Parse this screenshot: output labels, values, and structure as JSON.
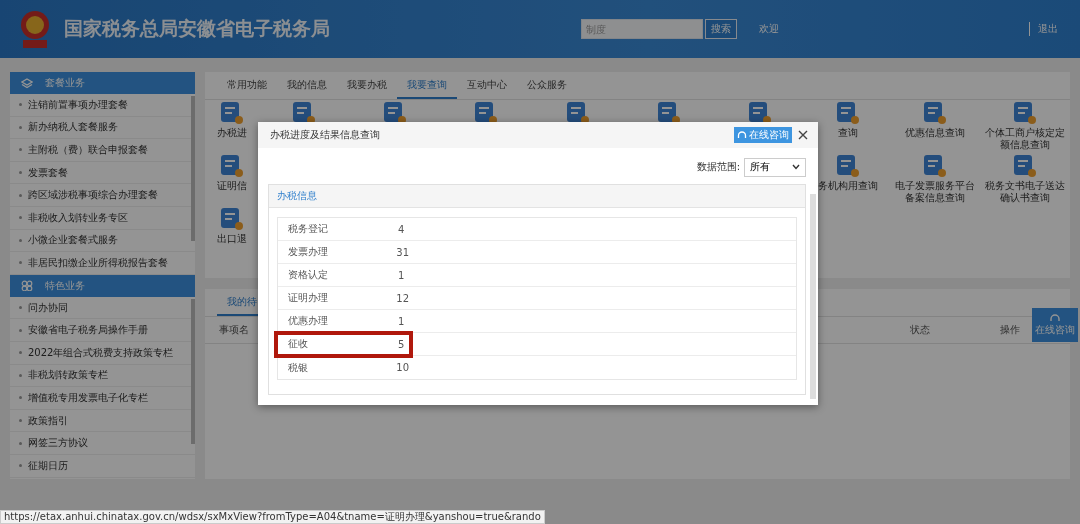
{
  "header": {
    "title": "国家税务总局安徽省电子税务局",
    "search": {
      "placeholder": "制度"
    },
    "search_button": "搜索",
    "welcome": "欢迎",
    "logout": "退出"
  },
  "sidebar": {
    "sections": [
      {
        "title": "套餐业务",
        "items": [
          "注销前置事项办理套餐",
          "新办纳税人套餐服务",
          "主附税（费）联合申报套餐",
          "发票套餐",
          "跨区域涉税事项综合办理套餐",
          "非税收入划转业务专区",
          "小微企业套餐式服务",
          "非居民扣缴企业所得税报告套餐"
        ]
      },
      {
        "title": "特色业务",
        "items": [
          "问办协同",
          "安徽省电子税务局操作手册",
          "2022年组合式税费支持政策专栏",
          "非税划转政策专栏",
          "增值税专用发票电子化专栏",
          "政策指引",
          "网签三方协议",
          "征期日历"
        ]
      }
    ]
  },
  "tabs": [
    {
      "label": "常用功能",
      "selected": false
    },
    {
      "label": "我的信息",
      "selected": false
    },
    {
      "label": "我要办税",
      "selected": false
    },
    {
      "label": "我要查询",
      "selected": true
    },
    {
      "label": "互动中心",
      "selected": false
    },
    {
      "label": "公众服务",
      "selected": false
    }
  ],
  "services": [
    [
      {
        "kind": "labeled",
        "label": "办税进"
      },
      {
        "kind": "icon"
      },
      {
        "kind": "icon"
      },
      {
        "kind": "icon"
      },
      {
        "kind": "icon"
      },
      {
        "kind": "icon"
      },
      {
        "kind": "icon"
      },
      {
        "kind": "labeled",
        "label": "查询"
      },
      {
        "kind": "labeled",
        "label": "优惠信息查询"
      },
      {
        "kind": "labeled",
        "label": "个体工商户核定定额信息查询"
      }
    ],
    [
      {
        "kind": "labeled",
        "label": "证明信"
      },
      {
        "kind": "blank"
      },
      {
        "kind": "blank"
      },
      {
        "kind": "blank"
      },
      {
        "kind": "blank"
      },
      {
        "kind": "blank"
      },
      {
        "kind": "blank"
      },
      {
        "kind": "labeled",
        "label": "务机构用查询"
      },
      {
        "kind": "labeled",
        "label": "电子发票服务平台备案信息查询"
      },
      {
        "kind": "labeled",
        "label": "税务文书电子送达确认书查询"
      }
    ],
    [
      {
        "kind": "labeled",
        "label": "出口退"
      }
    ]
  ],
  "todo": {
    "tab": "我的待",
    "columns": [
      "事项名",
      "状态",
      "操作"
    ]
  },
  "float_button": "在线咨询",
  "modal": {
    "title": "办税进度及结果信息查询",
    "consult_button": "在线咨询",
    "filter": {
      "label": "数据范围:",
      "value": "所有"
    },
    "panel_title": "办税信息",
    "rows": [
      {
        "name": "税务登记",
        "count": "4",
        "highlighted": false
      },
      {
        "name": "发票办理",
        "count": "31",
        "highlighted": false
      },
      {
        "name": "资格认定",
        "count": "1",
        "highlighted": false
      },
      {
        "name": "证明办理",
        "count": "12",
        "highlighted": false
      },
      {
        "name": "优惠办理",
        "count": "1",
        "highlighted": false
      },
      {
        "name": "征收",
        "count": "5",
        "highlighted": true
      },
      {
        "name": "税银",
        "count": "10",
        "highlighted": false
      }
    ]
  },
  "status_url": "https://etax.anhui.chinatax.gov.cn/wdsx/sxMxView?fromType=A04&tname=证明办理&yanshou=true&rando"
}
